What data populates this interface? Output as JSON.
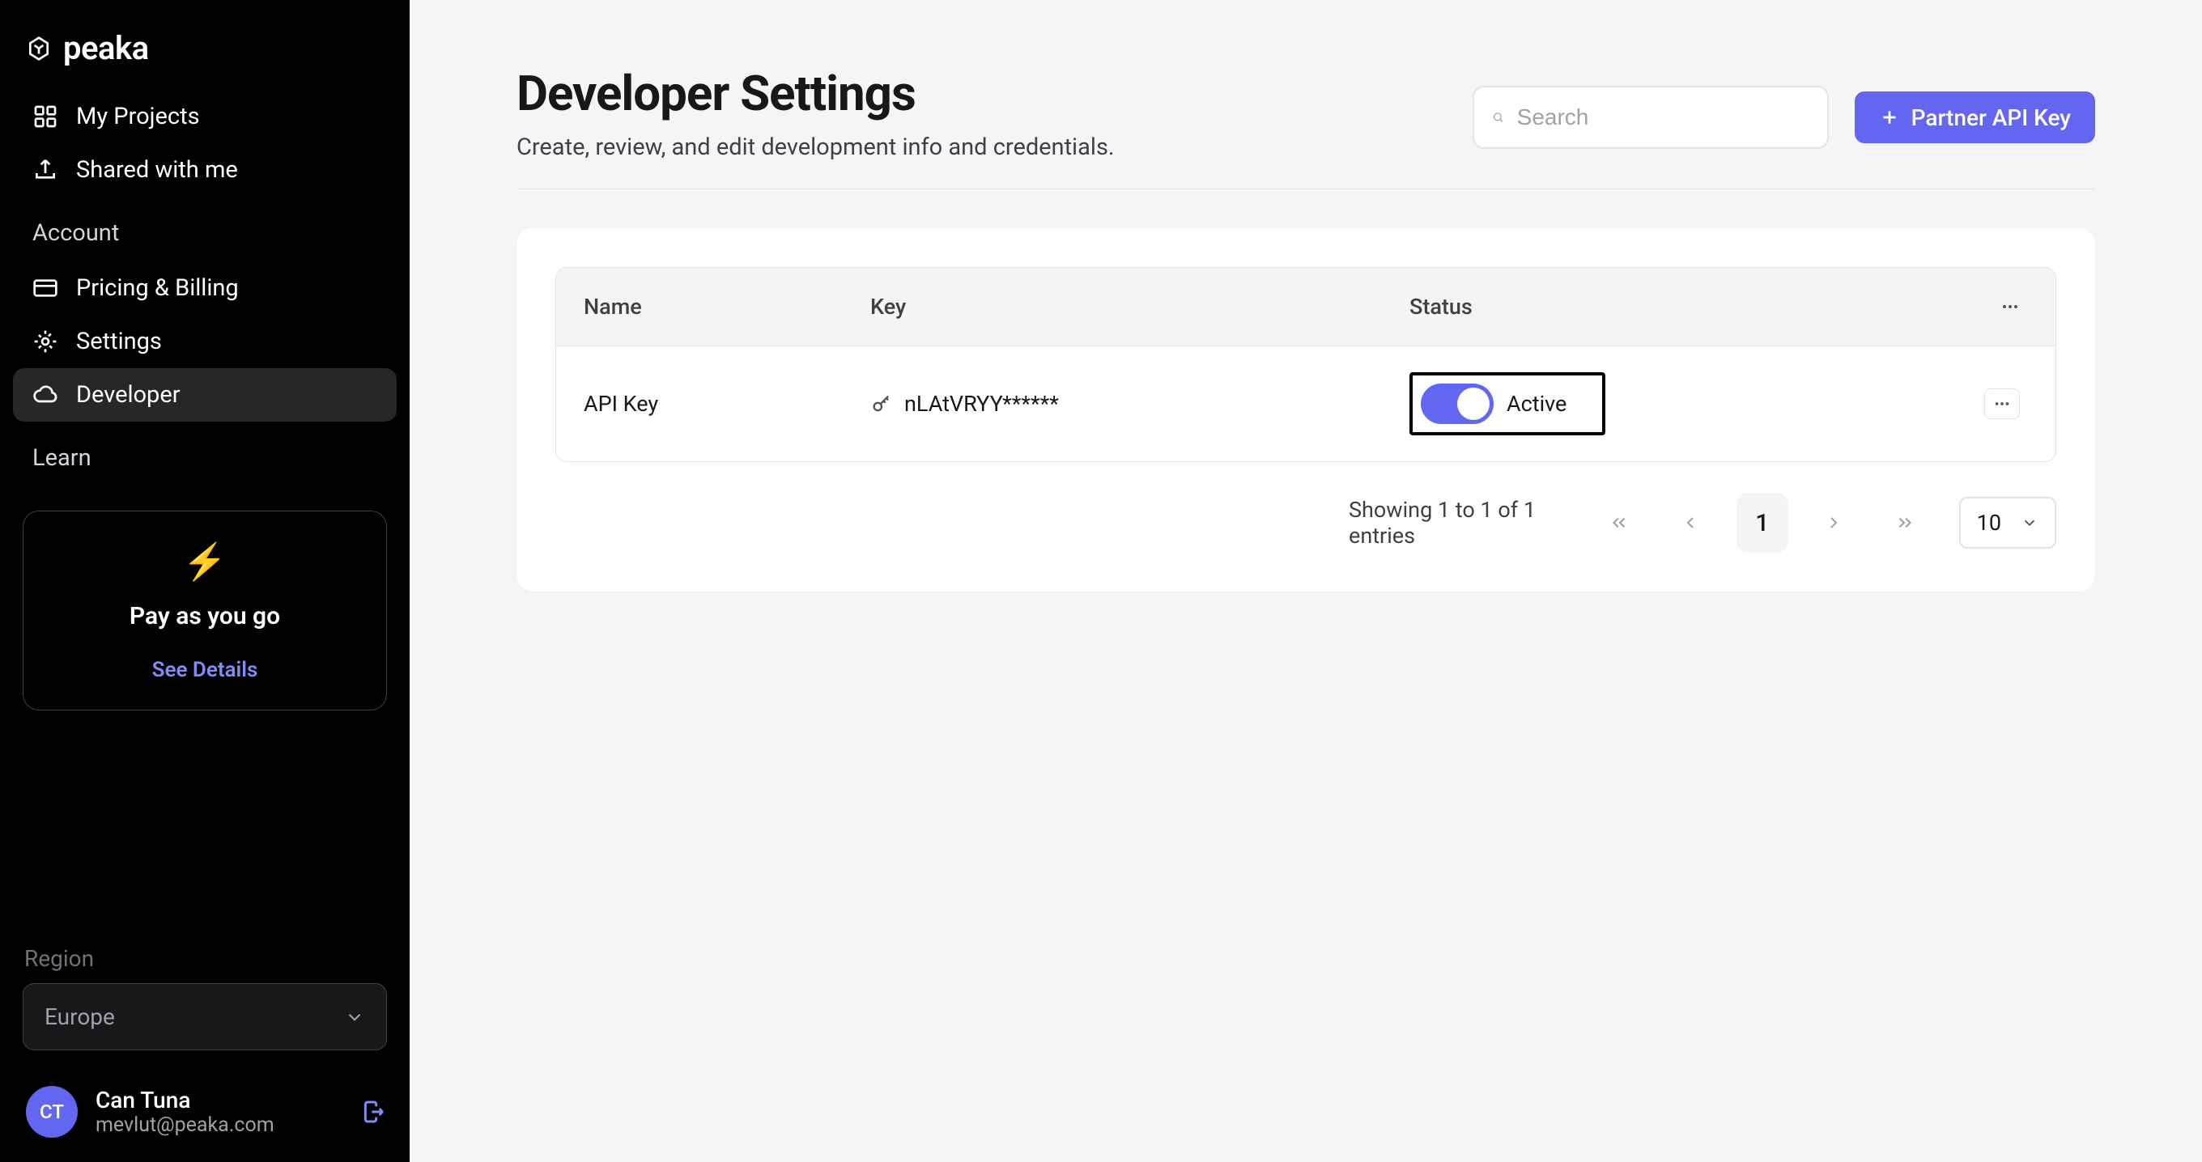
{
  "brand": {
    "name": "peaka"
  },
  "sidebar": {
    "nav": [
      {
        "label": "My Projects",
        "icon": "grid",
        "active": false
      },
      {
        "label": "Shared with me",
        "icon": "share",
        "active": false
      }
    ],
    "sections": [
      {
        "title": "Account",
        "items": [
          {
            "label": "Pricing & Billing",
            "icon": "card",
            "active": false
          },
          {
            "label": "Settings",
            "icon": "gear",
            "active": false
          },
          {
            "label": "Developer",
            "icon": "cloud",
            "active": true
          }
        ]
      },
      {
        "title": "Learn",
        "items": []
      }
    ],
    "plan": {
      "title": "Pay as you go",
      "link": "See Details",
      "emoji": "⚡"
    },
    "region": {
      "label": "Region",
      "value": "Europe"
    },
    "user": {
      "initials": "CT",
      "name": "Can Tuna",
      "email": "mevlut@peaka.com"
    }
  },
  "page": {
    "title": "Developer Settings",
    "subtitle": "Create, review, and edit development info and credentials.",
    "search_placeholder": "Search",
    "cta": "Partner API Key"
  },
  "table": {
    "headers": {
      "name": "Name",
      "key": "Key",
      "status": "Status"
    },
    "rows": [
      {
        "name": "API Key",
        "key": "nLAtVRYY******",
        "status_on": true,
        "status_label": "Active"
      }
    ]
  },
  "pagination": {
    "info": "Showing 1 to 1 of 1 entries",
    "current": "1",
    "page_size": "10"
  }
}
